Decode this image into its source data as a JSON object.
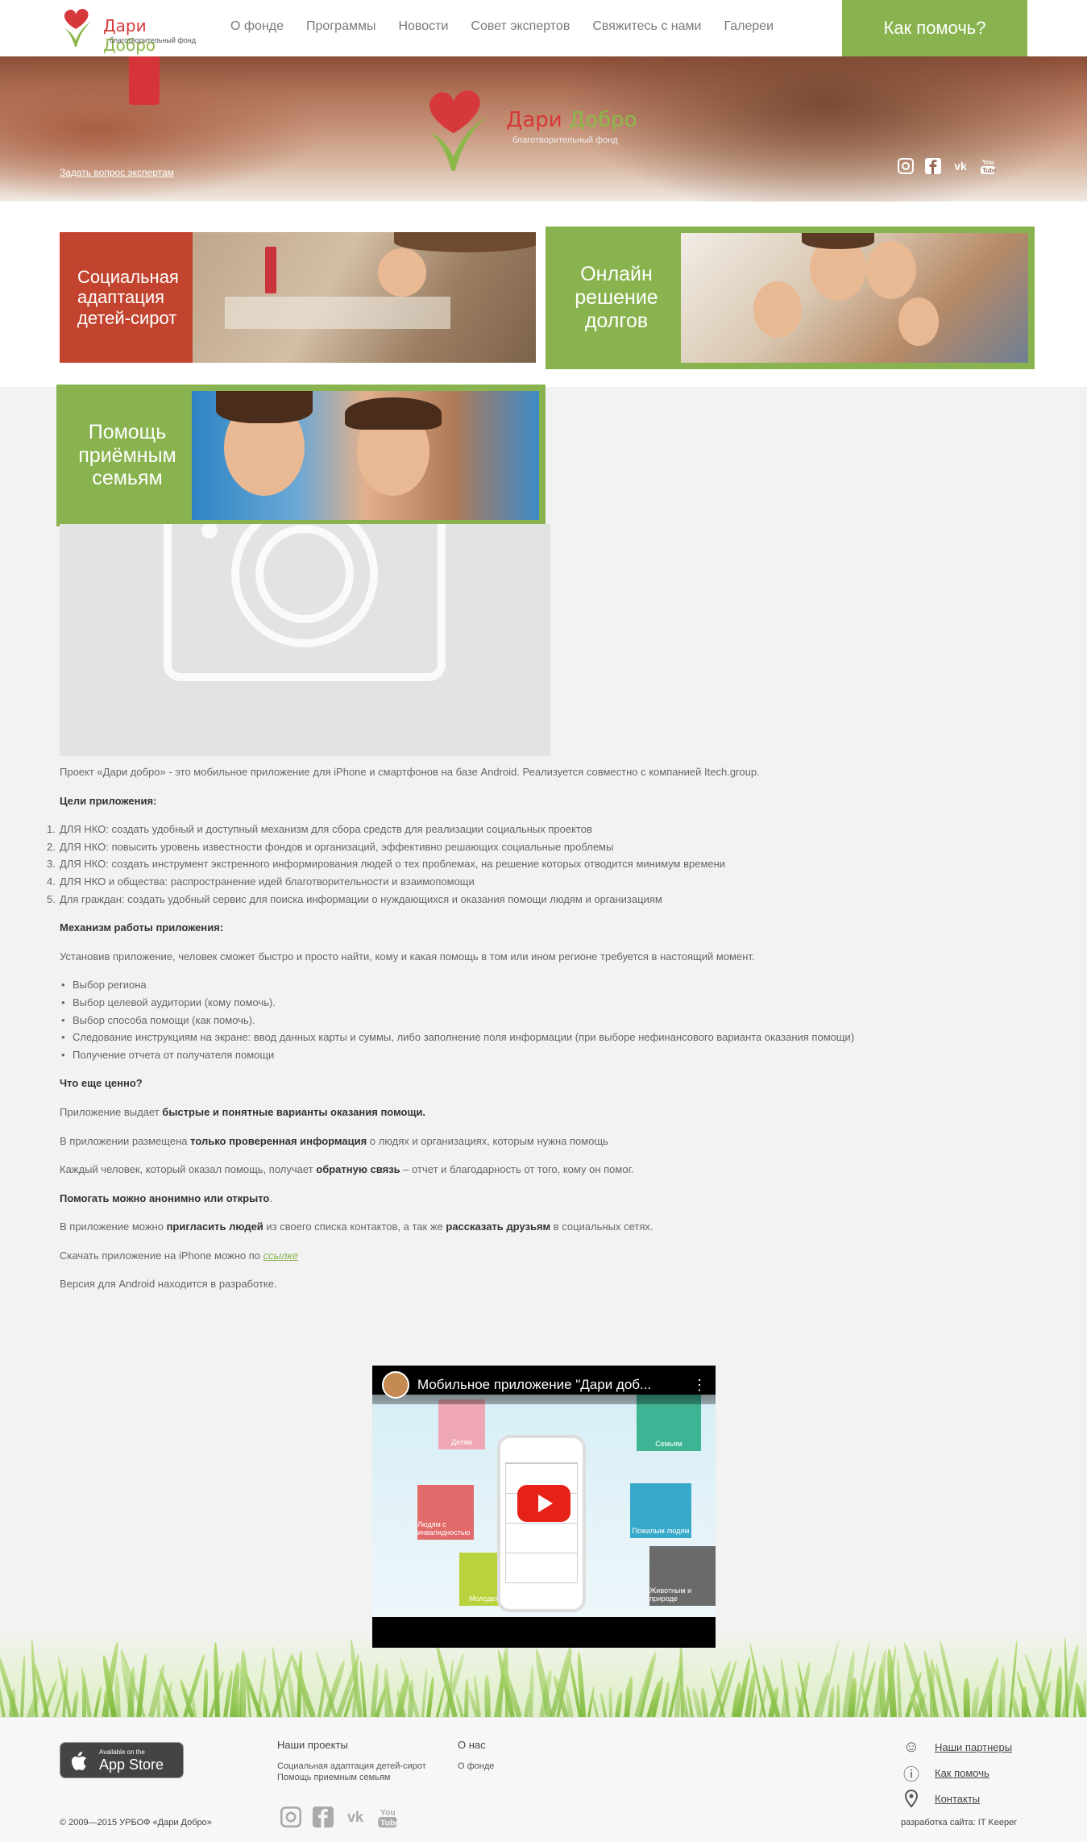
{
  "header": {
    "logo": {
      "title_part1": "Дари",
      "title_part2": "Добро",
      "subtitle": "благотворительный фонд"
    },
    "nav": [
      "О фонде",
      "Программы",
      "Новости",
      "Совет экспертов",
      "Свяжитесь с нами",
      "Галереи"
    ],
    "help_button": "Как помочь?"
  },
  "hero": {
    "logo": {
      "title_part1": "Дари",
      "title_part2": "Добро",
      "subtitle": "благотворительный фонд"
    },
    "ask_link": "Задать вопрос экспертам",
    "social": [
      "instagram-icon",
      "facebook-icon",
      "vk-icon",
      "youtube-icon"
    ]
  },
  "programs": [
    {
      "label": "Социальная адаптация детей-сирот",
      "color": "#c2442e"
    },
    {
      "label": "Онлайн решение долгов",
      "color": "#89b34e"
    },
    {
      "label": "Помощь приёмным семьям",
      "color": "#89b34e"
    }
  ],
  "article": {
    "intro": "Проект «Дари добро» - это мобильное приложение для iPhone и смартфонов на базе Android. Реализуется совместно с компанией Itech.group.",
    "goals_title": "Цели приложения:",
    "goals": [
      "ДЛЯ НКО: создать удобный и доступный механизм для сбора средств для реализации социальных проектов",
      "ДЛЯ НКО: повысить уровень известности фондов и организаций, эффективно решающих социальные проблемы",
      "ДЛЯ НКО: создать инструмент экстренного информирования людей о тех проблемах, на решение которых отводится минимум времени",
      "ДЛЯ НКО и общества: распространение идей благотворительности и взаимопомощи",
      "Для граждан: создать удобный сервис для поиска информации о нуждающихся и оказания помощи людям и организациям"
    ],
    "mechanism_title": "Механизм работы приложения:",
    "mechanism_intro": "Установив приложение, человек сможет быстро и просто найти, кому и какая помощь в том или ином регионе требуется в настоящий момент.",
    "steps": [
      "Выбор региона",
      "Выбор целевой аудитории (кому помочь).",
      "Выбор способа помощи (как помочь).",
      "Следование инструкциям на экране: ввод данных карты и суммы, либо заполнение поля информации (при выборе нефинансового варианта оказания помощи)",
      "Получение отчета от получателя помощи"
    ],
    "value_title": "Что еще ценно?",
    "p1_pre": "Приложение выдает ",
    "p1_bold": "быстрые и понятные варианты оказания помощи.",
    "p2_pre": "В приложении размещена  ",
    "p2_bold": "только проверенная информация",
    "p2_post": " о людях и организациях, которым нужна помощь",
    "p3_pre": "Каждый человек, который оказал помощь, получает ",
    "p3_bold": "обратную связь",
    "p3_post": " – отчет и благодарность от того, кому он помог.",
    "p4_bold": "Помогать можно анонимно или открыто",
    "p4_post": ".",
    "p5_pre": "В приложение можно ",
    "p5_bold1": "пригласить людей",
    "p5_mid": " из своего списка контактов, а так же ",
    "p5_bold2": "рассказать друзьям",
    "p5_post": " в социальных сетях.",
    "p6_pre": "Скачать приложение на iPhone можно по ",
    "p6_link": "ссылке",
    "p7": "Версия для Android находится в разработке."
  },
  "video": {
    "title": "Мобильное приложение \"Дари доб...",
    "tiles": [
      "Детям",
      "Семьям",
      "Людям с инвалидностью",
      "Пожилым людям",
      "Молодежи",
      "Животным и природе"
    ]
  },
  "footer": {
    "appstore": {
      "line1": "Available on the",
      "line2": "App Store"
    },
    "copyright": "© 2009—2015 УРБОФ «Дари Добро»",
    "projects_title": "Наши проекты",
    "projects": [
      "Социальная адаптация детей-сирот",
      "Помощь приемным семьям"
    ],
    "about_title": "О нас",
    "about": [
      "О фонде"
    ],
    "social": [
      "instagram-icon",
      "facebook-icon",
      "vk-icon",
      "youtube-icon"
    ],
    "links": [
      {
        "icon": "smile-icon",
        "label": "Наши партнеры"
      },
      {
        "icon": "info-icon",
        "label": "Как помочь"
      },
      {
        "icon": "location-pin-icon",
        "label": "Контакты"
      }
    ],
    "developer": "разработка сайта: IT Keeper"
  }
}
